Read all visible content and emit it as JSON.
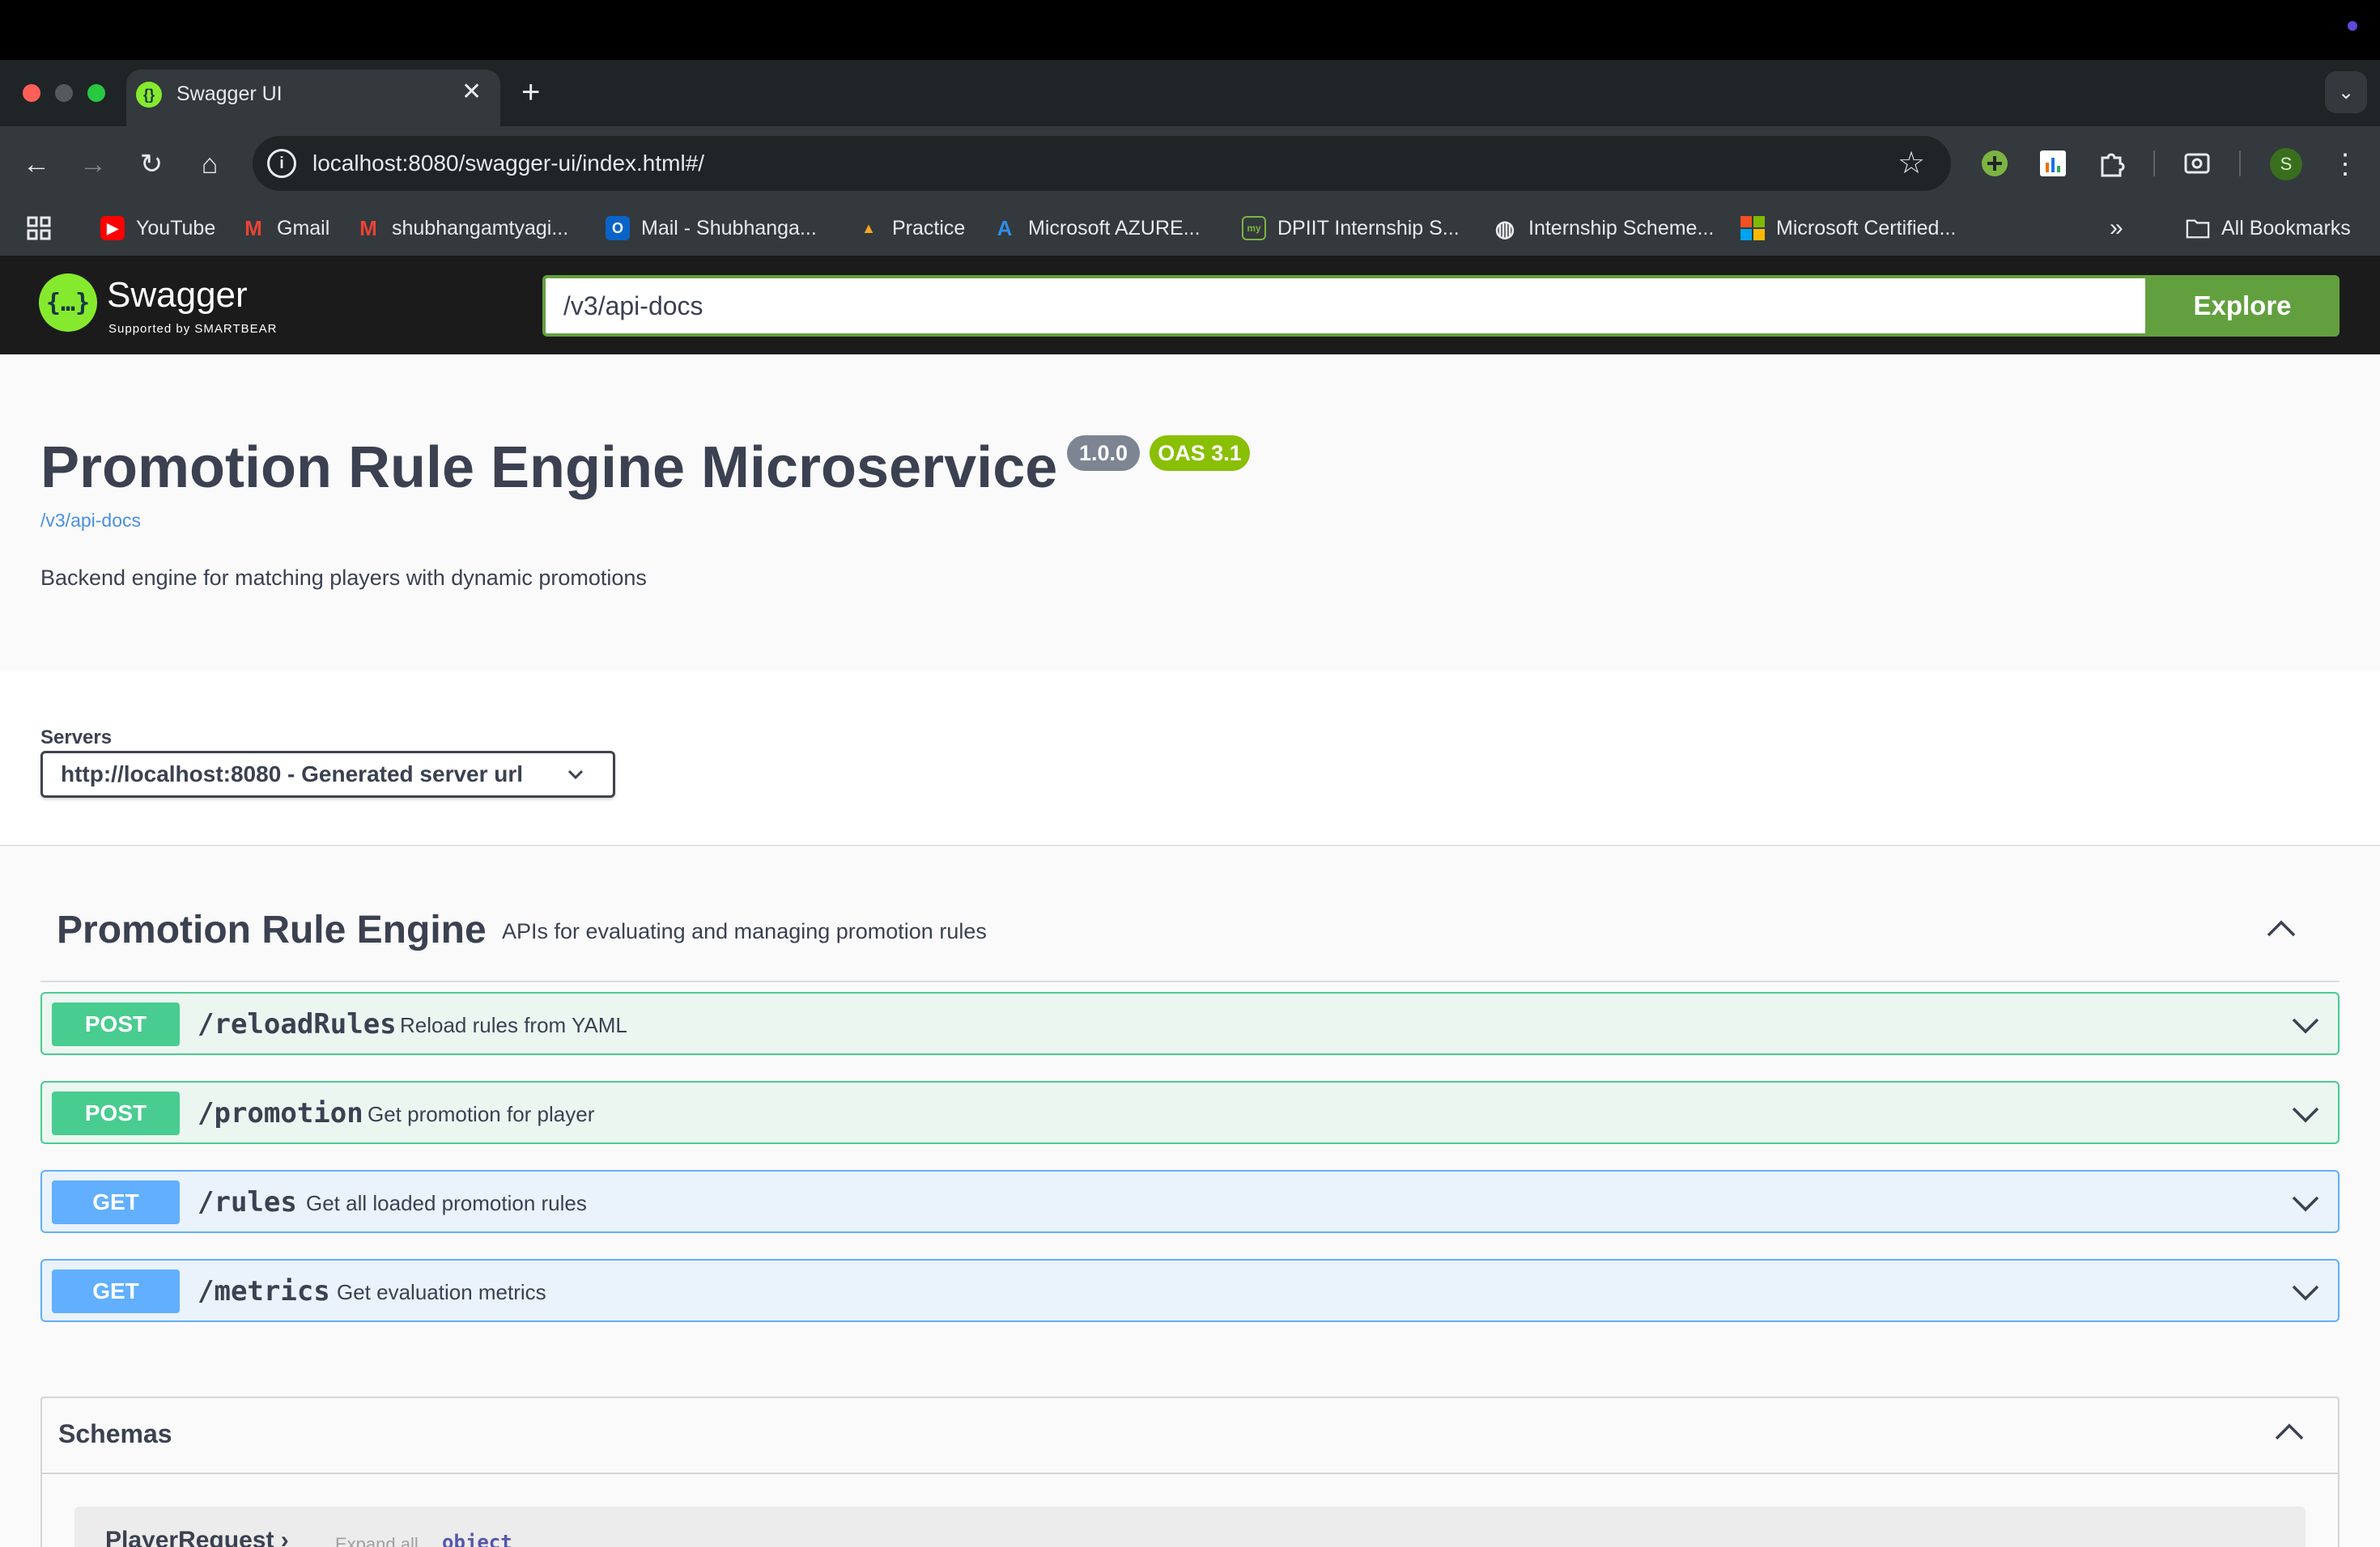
{
  "browser": {
    "tab_title": "Swagger UI",
    "url": "localhost:8080/swagger-ui/index.html#/",
    "profile_initial": "S",
    "bookmarks": [
      {
        "label": "YouTube"
      },
      {
        "label": "Gmail"
      },
      {
        "label": "shubhangamtyagi..."
      },
      {
        "label": "Mail - Shubhanga..."
      },
      {
        "label": "Practice"
      },
      {
        "label": "Microsoft AZURE..."
      },
      {
        "label": "DPIIT Internship S..."
      },
      {
        "label": "Internship Scheme..."
      },
      {
        "label": "Microsoft Certified..."
      }
    ],
    "all_bookmarks": "All Bookmarks"
  },
  "swagger_bar": {
    "logo_text": "Swagger",
    "logo_sub": "Supported by SMARTBEAR",
    "spec_url": "/v3/api-docs",
    "explore_label": "Explore"
  },
  "info": {
    "title": "Promotion Rule Engine Microservice",
    "version": "1.0.0",
    "oas": "OAS 3.1",
    "spec_link": "/v3/api-docs",
    "description": "Backend engine for matching players with dynamic promotions"
  },
  "servers": {
    "label": "Servers",
    "selected": "http://localhost:8080 - Generated server url"
  },
  "tag": {
    "name": "Promotion Rule Engine",
    "description": "APIs for evaluating and managing promotion rules"
  },
  "operations": [
    {
      "method": "POST",
      "path": "/reloadRules",
      "summary": "Reload rules from YAML"
    },
    {
      "method": "POST",
      "path": "/promotion",
      "summary": "Get promotion for player"
    },
    {
      "method": "GET",
      "path": "/rules",
      "summary": "Get all loaded promotion rules"
    },
    {
      "method": "GET",
      "path": "/metrics",
      "summary": "Get evaluation metrics"
    }
  ],
  "schemas": {
    "title": "Schemas",
    "first_model": "PlayerRequest",
    "expand_all": "Expand all",
    "type": "object"
  },
  "colors": {
    "post": "#49cc90",
    "get": "#61affe",
    "swagger_green": "#62a03f"
  }
}
